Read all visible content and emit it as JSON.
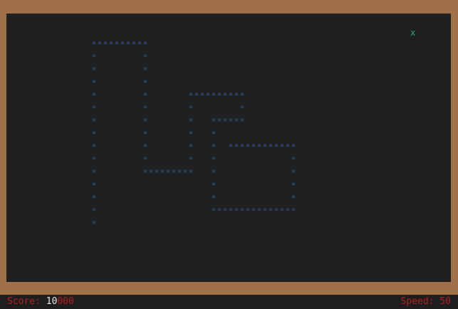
{
  "game": {
    "snake_glyph": "*",
    "food_glyph": "x",
    "colors": {
      "border": "#a07048",
      "board": "#202020",
      "snake": "#2a5e9c",
      "food": "#3aa37a",
      "status_text": "#b81e1e",
      "score_highlight": "#e8e8e8"
    }
  },
  "status": {
    "score_label": "Score: ",
    "score_highlight": "10",
    "score_rest": "000",
    "speed_text": "Speed: 50"
  }
}
